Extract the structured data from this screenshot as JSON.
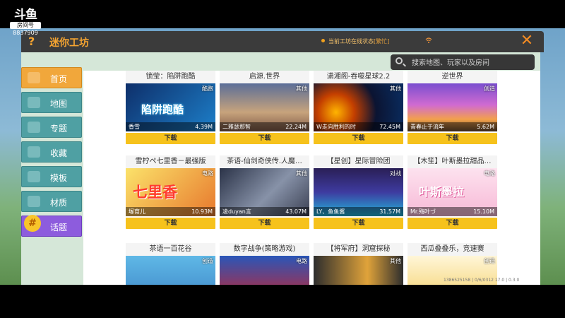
{
  "brand": {
    "logo": "斗鱼",
    "room_badge": "房间号",
    "room_number": "8837909"
  },
  "header": {
    "question_mark": "?",
    "title": "迷你工坊",
    "status_prefix": "当前工坊在线状态",
    "status_value": "[繁忙]",
    "close_symbol": "✕"
  },
  "search": {
    "placeholder": "搜索地图、玩家以及房间"
  },
  "sidebar": {
    "items": [
      {
        "label": "首页",
        "active": true
      },
      {
        "label": "地图",
        "active": false
      },
      {
        "label": "专题",
        "active": false
      },
      {
        "label": "收藏",
        "active": false
      },
      {
        "label": "模板",
        "active": false
      },
      {
        "label": "材质",
        "active": false
      },
      {
        "label": "话题",
        "active": false
      }
    ]
  },
  "cards": [
    {
      "title": "锁莹：陷阱跑酷",
      "tag": "酷跑",
      "author": "香雪",
      "size": "4.39M",
      "download": "下载",
      "thumb_text": "陷阱跑酷"
    },
    {
      "title": "启源.世界",
      "tag": "其他",
      "author": "二雅瑟那智",
      "size": "22.24M",
      "download": "下载",
      "thumb_text": ""
    },
    {
      "title": "潇湘阁-吞噬星球2.2",
      "tag": "其他",
      "author": "W走向胜利的时",
      "size": "72.45M",
      "download": "下载",
      "thumb_text": ""
    },
    {
      "title": "逆世界",
      "tag": "创造",
      "author": "青春止于流年",
      "size": "5.62M",
      "download": "下载",
      "thumb_text": ""
    },
    {
      "title": "雪柠ぺ七里香－最强版",
      "tag": "电路",
      "author": "塚育儿",
      "size": "10.93M",
      "download": "下载",
      "thumb_text": "七里香"
    },
    {
      "title": "茶语-仙剑奇侠传.人魔…",
      "tag": "其他",
      "author": "凌duyan言",
      "size": "43.07M",
      "download": "下载",
      "thumb_text": ""
    },
    {
      "title": "【星创】星际冒险团",
      "tag": "对战",
      "author": "LY、鱼鱼酱",
      "size": "31.57M",
      "download": "下载",
      "thumb_text": ""
    },
    {
      "title": "【木笙】叶斯墨拉甜品…",
      "tag": "电路",
      "author": "Mr.殇叶づ",
      "size": "15.10M",
      "download": "下载",
      "thumb_text": "叶斯墨拉"
    },
    {
      "title": "茶语一百花谷",
      "tag": "创造",
      "author": "",
      "size": "",
      "download": "",
      "thumb_text": ""
    },
    {
      "title": "数字战争(策略游戏)",
      "tag": "电路",
      "author": "",
      "size": "",
      "download": "",
      "thumb_text": ""
    },
    {
      "title": "【将军府】洞窟探秘",
      "tag": "其他",
      "author": "",
      "size": "",
      "download": "",
      "thumb_text": ""
    },
    {
      "title": "西瓜叠叠乐，竞速赛",
      "tag": "创造",
      "author": "",
      "size": "",
      "download": "",
      "thumb_text": ""
    }
  ],
  "footer": {
    "text": "1386525158 | 0/6/0312 17.0 | 0.3.0"
  },
  "colors": {
    "accent": "#f6a531",
    "download": "#f6c21c",
    "nav": "#4fa0a3",
    "nav_active": "#f1a73b",
    "nav_topic": "#8d5cdd"
  }
}
